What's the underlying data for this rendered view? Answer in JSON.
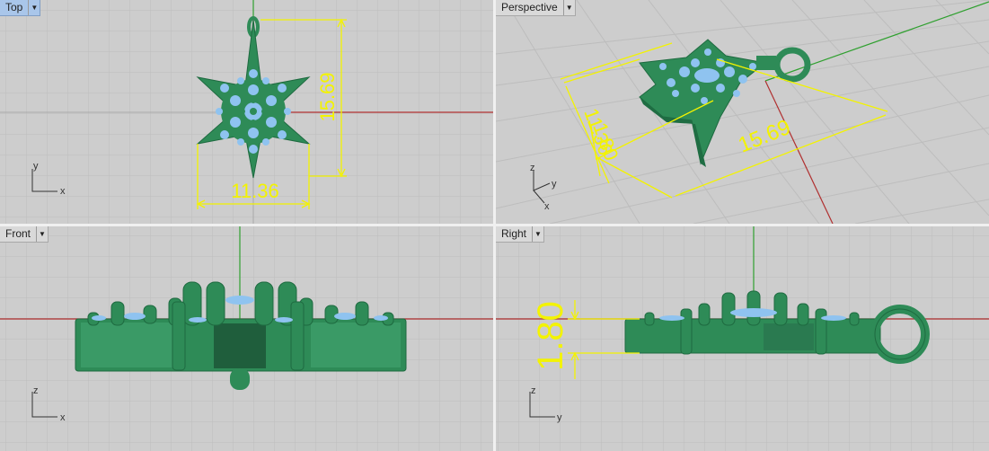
{
  "viewports": {
    "top": {
      "title": "Top",
      "dim_width": "11.36",
      "dim_height": "15.69",
      "axis_a": "y",
      "axis_b": "x"
    },
    "perspective": {
      "title": "Perspective",
      "dim_width": "11.36",
      "dim_height": "15.69",
      "dim_thickness": "1.80",
      "axis_z": "z",
      "axis_y": "y",
      "axis_x": "x"
    },
    "front": {
      "title": "Front",
      "axis_a": "z",
      "axis_b": "x"
    },
    "right": {
      "title": "Right",
      "dim_thickness": "1.80",
      "axis_a": "z",
      "axis_b": "y"
    }
  },
  "colors": {
    "viewport_bg": "#cdcdcd",
    "grid_minor": "#bcbcbc",
    "grid_major": "#a9a9a9",
    "x_axis": "#b03030",
    "y_axis": "#30a030",
    "model_green": "#2e8b57",
    "model_blue": "#8fc3f0",
    "dimension_yellow": "#f3f300",
    "active_tab": "#a9c6ea"
  }
}
